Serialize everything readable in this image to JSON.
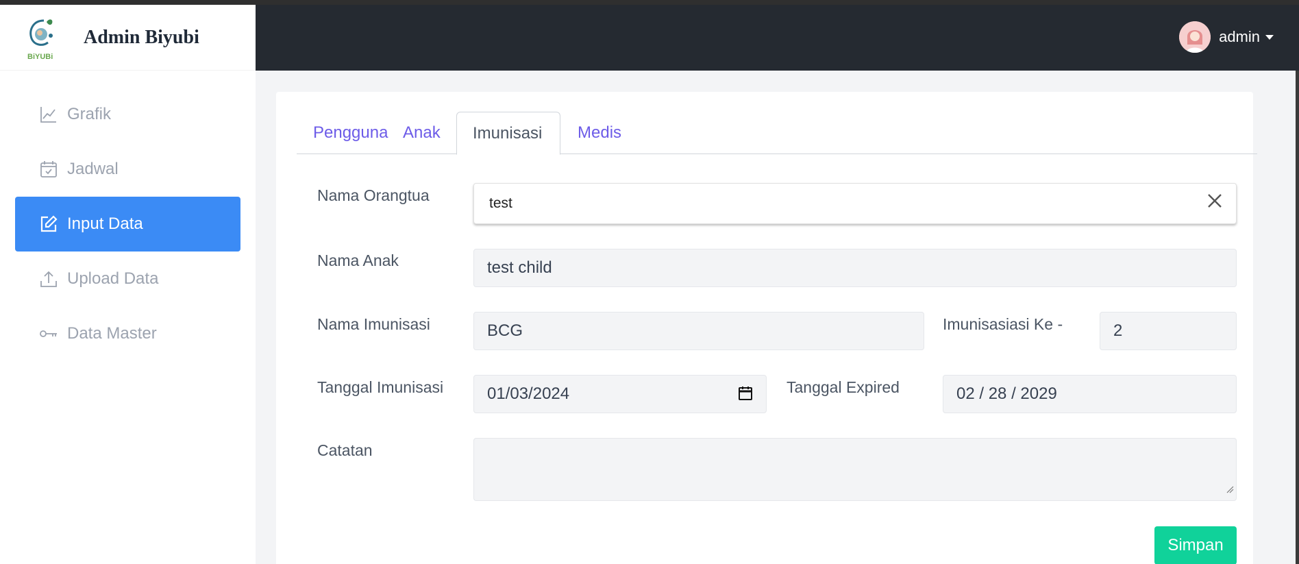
{
  "brand": {
    "title": "Admin Biyubi",
    "logo_text": "BiYUBi"
  },
  "sidebar": {
    "items": [
      {
        "label": "Grafik",
        "icon": "chart-line-icon"
      },
      {
        "label": "Jadwal",
        "icon": "calendar-icon"
      },
      {
        "label": "Input Data",
        "icon": "edit-icon",
        "active": true
      },
      {
        "label": "Upload Data",
        "icon": "upload-icon"
      },
      {
        "label": "Data Master",
        "icon": "key-icon"
      }
    ]
  },
  "header": {
    "user_name": "admin"
  },
  "tabs": [
    {
      "label": "Pengguna"
    },
    {
      "label": "Anak"
    },
    {
      "label": "Imunisasi",
      "active": true
    },
    {
      "label": "Medis"
    }
  ],
  "form": {
    "nama_orangtua": {
      "label": "Nama Orangtua",
      "value": "test"
    },
    "nama_anak": {
      "label": "Nama Anak",
      "value": "test child"
    },
    "nama_imunisasi": {
      "label": "Nama Imunisasi",
      "value": "BCG"
    },
    "imunisasi_ke": {
      "label": "Imunisasiasi Ke -",
      "value": "2"
    },
    "tanggal_imunisasi": {
      "label": "Tanggal Imunisasi",
      "value": "01/03/2024"
    },
    "tanggal_expired": {
      "label": "Tanggal Expired",
      "value": "02 / 28 / 2029"
    },
    "catatan": {
      "label": "Catatan",
      "value": ""
    },
    "submit_label": "Simpan"
  },
  "colors": {
    "accent": "#3b8bf5",
    "tab_link": "#6d5ce8",
    "submit": "#10d29a",
    "header_bg": "#252a31"
  }
}
